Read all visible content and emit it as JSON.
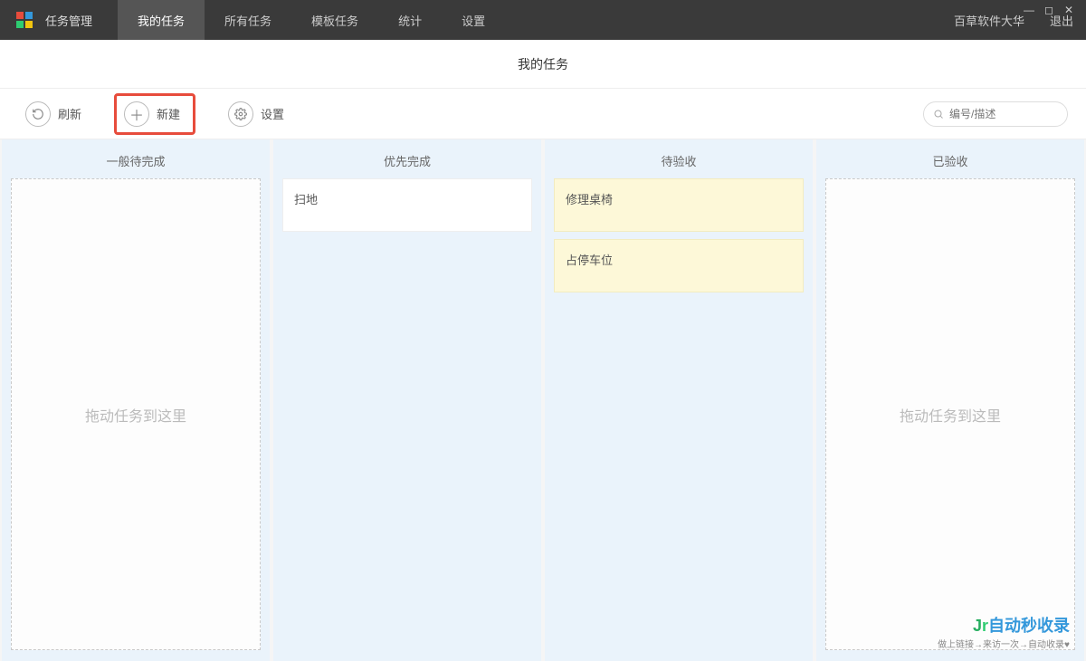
{
  "topbar": {
    "brand": "任务管理",
    "nav": [
      "我的任务",
      "所有任务",
      "模板任务",
      "统计",
      "设置"
    ],
    "active_index": 0,
    "right_links": [
      "百草软件大华",
      "退出"
    ]
  },
  "page_title": "我的任务",
  "toolbar": {
    "refresh_label": "刷新",
    "new_label": "新建",
    "settings_label": "设置",
    "search_placeholder": "编号/描述"
  },
  "board": {
    "lanes": [
      {
        "title": "一般待完成",
        "empty_text": "拖动任务到这里",
        "cards": []
      },
      {
        "title": "优先完成",
        "empty_text": "",
        "cards": [
          {
            "text": "扫地",
            "color": "white"
          }
        ]
      },
      {
        "title": "待验收",
        "empty_text": "",
        "cards": [
          {
            "text": "修理桌椅",
            "color": "yellow"
          },
          {
            "text": "占停车位",
            "color": "yellow"
          }
        ]
      },
      {
        "title": "已验收",
        "empty_text": "拖动任务到这里",
        "cards": []
      }
    ]
  },
  "watermark": {
    "main": "自动秒收录",
    "sub": "做上链接→来访一次→自动收录♥"
  }
}
